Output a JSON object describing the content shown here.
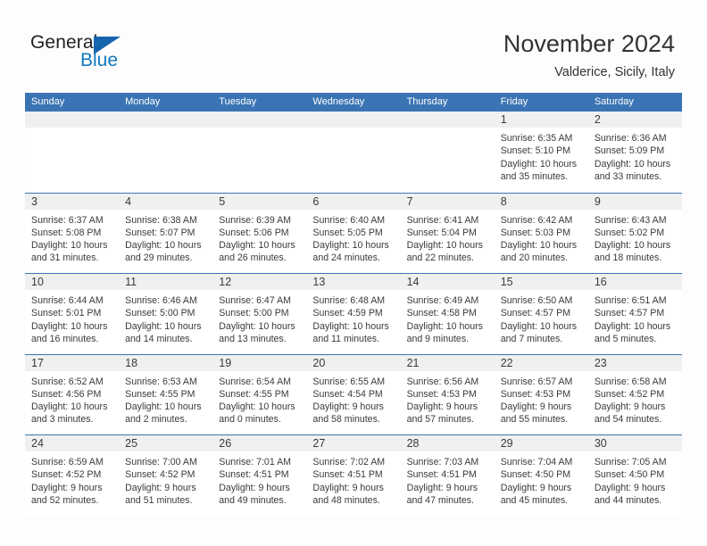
{
  "logo": {
    "word_one": "General",
    "word_two": "Blue",
    "triangle_color": "#1565ad",
    "blue_text_color": "#1278be"
  },
  "header": {
    "title": "November 2024",
    "subtitle": "Valderice, Sicily, Italy"
  },
  "theme": {
    "header_blue": "#3b74b4",
    "band_gray": "#f0f0f0",
    "text_color": "#3a3a3a"
  },
  "weekdays": [
    "Sunday",
    "Monday",
    "Tuesday",
    "Wednesday",
    "Thursday",
    "Friday",
    "Saturday"
  ],
  "weeks": [
    [
      {
        "date": "",
        "lines": []
      },
      {
        "date": "",
        "lines": []
      },
      {
        "date": "",
        "lines": []
      },
      {
        "date": "",
        "lines": []
      },
      {
        "date": "",
        "lines": []
      },
      {
        "date": "1",
        "lines": [
          "Sunrise: 6:35 AM",
          "Sunset: 5:10 PM",
          "Daylight: 10 hours",
          "and 35 minutes."
        ]
      },
      {
        "date": "2",
        "lines": [
          "Sunrise: 6:36 AM",
          "Sunset: 5:09 PM",
          "Daylight: 10 hours",
          "and 33 minutes."
        ]
      }
    ],
    [
      {
        "date": "3",
        "lines": [
          "Sunrise: 6:37 AM",
          "Sunset: 5:08 PM",
          "Daylight: 10 hours",
          "and 31 minutes."
        ]
      },
      {
        "date": "4",
        "lines": [
          "Sunrise: 6:38 AM",
          "Sunset: 5:07 PM",
          "Daylight: 10 hours",
          "and 29 minutes."
        ]
      },
      {
        "date": "5",
        "lines": [
          "Sunrise: 6:39 AM",
          "Sunset: 5:06 PM",
          "Daylight: 10 hours",
          "and 26 minutes."
        ]
      },
      {
        "date": "6",
        "lines": [
          "Sunrise: 6:40 AM",
          "Sunset: 5:05 PM",
          "Daylight: 10 hours",
          "and 24 minutes."
        ]
      },
      {
        "date": "7",
        "lines": [
          "Sunrise: 6:41 AM",
          "Sunset: 5:04 PM",
          "Daylight: 10 hours",
          "and 22 minutes."
        ]
      },
      {
        "date": "8",
        "lines": [
          "Sunrise: 6:42 AM",
          "Sunset: 5:03 PM",
          "Daylight: 10 hours",
          "and 20 minutes."
        ]
      },
      {
        "date": "9",
        "lines": [
          "Sunrise: 6:43 AM",
          "Sunset: 5:02 PM",
          "Daylight: 10 hours",
          "and 18 minutes."
        ]
      }
    ],
    [
      {
        "date": "10",
        "lines": [
          "Sunrise: 6:44 AM",
          "Sunset: 5:01 PM",
          "Daylight: 10 hours",
          "and 16 minutes."
        ]
      },
      {
        "date": "11",
        "lines": [
          "Sunrise: 6:46 AM",
          "Sunset: 5:00 PM",
          "Daylight: 10 hours",
          "and 14 minutes."
        ]
      },
      {
        "date": "12",
        "lines": [
          "Sunrise: 6:47 AM",
          "Sunset: 5:00 PM",
          "Daylight: 10 hours",
          "and 13 minutes."
        ]
      },
      {
        "date": "13",
        "lines": [
          "Sunrise: 6:48 AM",
          "Sunset: 4:59 PM",
          "Daylight: 10 hours",
          "and 11 minutes."
        ]
      },
      {
        "date": "14",
        "lines": [
          "Sunrise: 6:49 AM",
          "Sunset: 4:58 PM",
          "Daylight: 10 hours",
          "and 9 minutes."
        ]
      },
      {
        "date": "15",
        "lines": [
          "Sunrise: 6:50 AM",
          "Sunset: 4:57 PM",
          "Daylight: 10 hours",
          "and 7 minutes."
        ]
      },
      {
        "date": "16",
        "lines": [
          "Sunrise: 6:51 AM",
          "Sunset: 4:57 PM",
          "Daylight: 10 hours",
          "and 5 minutes."
        ]
      }
    ],
    [
      {
        "date": "17",
        "lines": [
          "Sunrise: 6:52 AM",
          "Sunset: 4:56 PM",
          "Daylight: 10 hours",
          "and 3 minutes."
        ]
      },
      {
        "date": "18",
        "lines": [
          "Sunrise: 6:53 AM",
          "Sunset: 4:55 PM",
          "Daylight: 10 hours",
          "and 2 minutes."
        ]
      },
      {
        "date": "19",
        "lines": [
          "Sunrise: 6:54 AM",
          "Sunset: 4:55 PM",
          "Daylight: 10 hours",
          "and 0 minutes."
        ]
      },
      {
        "date": "20",
        "lines": [
          "Sunrise: 6:55 AM",
          "Sunset: 4:54 PM",
          "Daylight: 9 hours",
          "and 58 minutes."
        ]
      },
      {
        "date": "21",
        "lines": [
          "Sunrise: 6:56 AM",
          "Sunset: 4:53 PM",
          "Daylight: 9 hours",
          "and 57 minutes."
        ]
      },
      {
        "date": "22",
        "lines": [
          "Sunrise: 6:57 AM",
          "Sunset: 4:53 PM",
          "Daylight: 9 hours",
          "and 55 minutes."
        ]
      },
      {
        "date": "23",
        "lines": [
          "Sunrise: 6:58 AM",
          "Sunset: 4:52 PM",
          "Daylight: 9 hours",
          "and 54 minutes."
        ]
      }
    ],
    [
      {
        "date": "24",
        "lines": [
          "Sunrise: 6:59 AM",
          "Sunset: 4:52 PM",
          "Daylight: 9 hours",
          "and 52 minutes."
        ]
      },
      {
        "date": "25",
        "lines": [
          "Sunrise: 7:00 AM",
          "Sunset: 4:52 PM",
          "Daylight: 9 hours",
          "and 51 minutes."
        ]
      },
      {
        "date": "26",
        "lines": [
          "Sunrise: 7:01 AM",
          "Sunset: 4:51 PM",
          "Daylight: 9 hours",
          "and 49 minutes."
        ]
      },
      {
        "date": "27",
        "lines": [
          "Sunrise: 7:02 AM",
          "Sunset: 4:51 PM",
          "Daylight: 9 hours",
          "and 48 minutes."
        ]
      },
      {
        "date": "28",
        "lines": [
          "Sunrise: 7:03 AM",
          "Sunset: 4:51 PM",
          "Daylight: 9 hours",
          "and 47 minutes."
        ]
      },
      {
        "date": "29",
        "lines": [
          "Sunrise: 7:04 AM",
          "Sunset: 4:50 PM",
          "Daylight: 9 hours",
          "and 45 minutes."
        ]
      },
      {
        "date": "30",
        "lines": [
          "Sunrise: 7:05 AM",
          "Sunset: 4:50 PM",
          "Daylight: 9 hours",
          "and 44 minutes."
        ]
      }
    ]
  ]
}
